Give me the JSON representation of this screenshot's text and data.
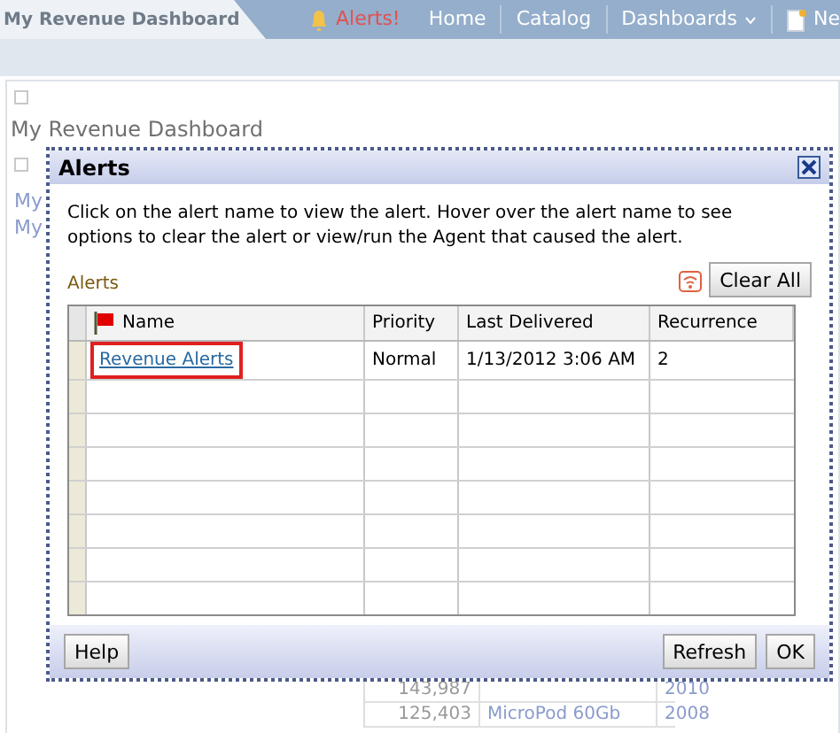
{
  "page_tab": {
    "label": "My Revenue Dashboard"
  },
  "nav": [
    {
      "kind": "alert",
      "label": "Alerts!"
    },
    {
      "kind": "link",
      "label": "Home"
    },
    {
      "kind": "link",
      "label": "Catalog"
    },
    {
      "kind": "menu",
      "label": "Dashboards"
    },
    {
      "kind": "new",
      "label": "Ne"
    }
  ],
  "section": {
    "title": "My Revenue Dashboard",
    "links": [
      "My",
      "My"
    ]
  },
  "background_table": {
    "rows": [
      [
        "143,987",
        "",
        "2010"
      ],
      [
        "125,403",
        "MicroPod 60Gb",
        "2008"
      ]
    ]
  },
  "dialog": {
    "title": "Alerts",
    "instructions": "Click on the alert name to view the alert. Hover over the alert name to see options to clear the alert or view/run the Agent that caused the alert.",
    "section_label": "Alerts",
    "clear_all": "Clear All",
    "columns": [
      "Name",
      "Priority",
      "Last Delivered",
      "Recurrence"
    ],
    "rows": [
      {
        "name": "Revenue Alerts",
        "priority": "Normal",
        "last_delivered": "1/13/2012 3:06 AM",
        "recurrence": "2",
        "highlighted": true
      }
    ],
    "buttons": {
      "help": "Help",
      "refresh": "Refresh",
      "ok": "OK"
    }
  }
}
